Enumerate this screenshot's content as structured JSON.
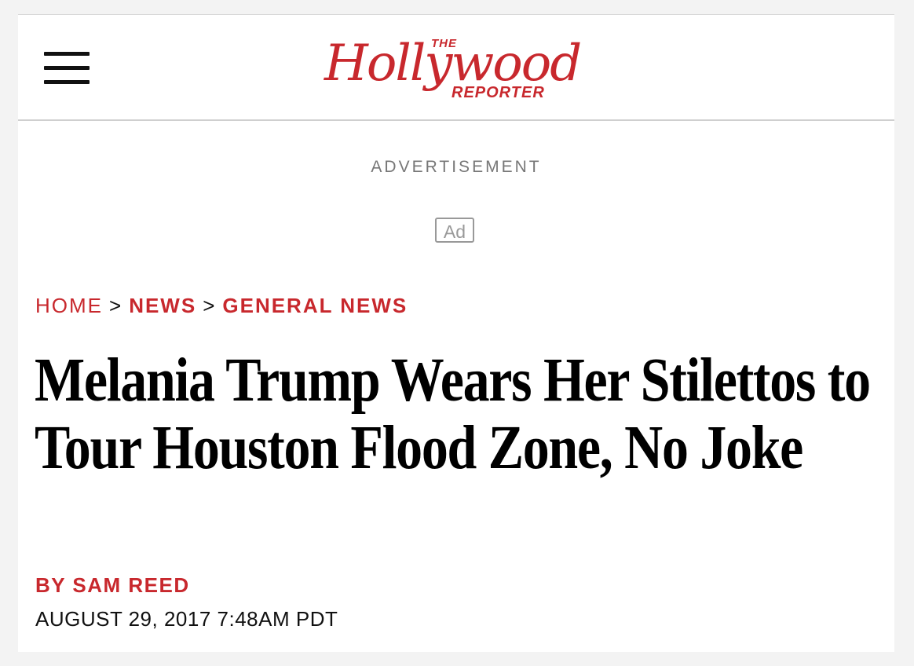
{
  "header": {
    "menu_icon": "hamburger-menu-icon",
    "logo": {
      "the": "THE",
      "main": "Hollywood",
      "reporter": "REPORTER"
    }
  },
  "ad": {
    "label": "ADVERTISEMENT",
    "badge": "Ad"
  },
  "breadcrumb": {
    "items": [
      "HOME",
      "NEWS",
      "GENERAL NEWS"
    ],
    "separator": ">"
  },
  "article": {
    "headline": "Melania Trump Wears Her Stilettos to Tour Houston Flood Zone, No Joke",
    "byline": "BY SAM REED",
    "date": "AUGUST 29, 2017 7:48AM PDT"
  },
  "colors": {
    "brand_red": "#c8282d",
    "text": "#000000",
    "background": "#f3f3f3"
  }
}
